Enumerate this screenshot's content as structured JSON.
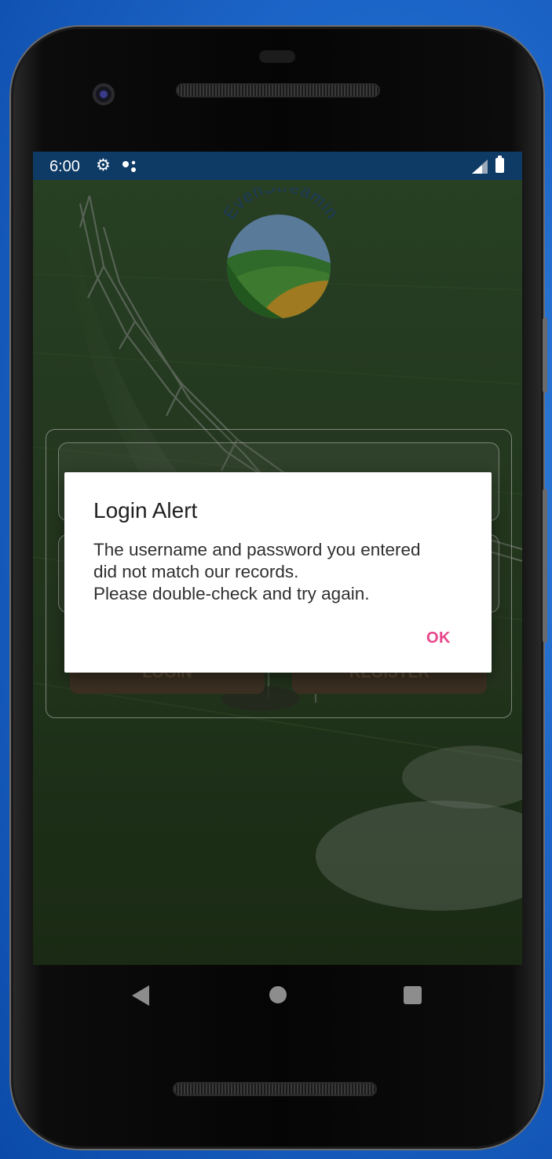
{
  "status_bar": {
    "time": "6:00",
    "icons": [
      "gear-icon",
      "assistant-dots-icon",
      "signal-icon",
      "battery-icon"
    ],
    "background": "#0e3a66"
  },
  "app": {
    "logo_text": "EvenStreamin",
    "login_button_label": "LOGIN",
    "register_button_label": "REGISTER"
  },
  "dialog": {
    "title": "Login Alert",
    "message": "The username and password you entered\ndid not match our records.\nPlease double-check and try again.",
    "ok_label": "OK",
    "ok_color": "#e8468a"
  },
  "nav_bar": {
    "icons": [
      "back-icon",
      "home-icon",
      "recents-icon"
    ]
  }
}
